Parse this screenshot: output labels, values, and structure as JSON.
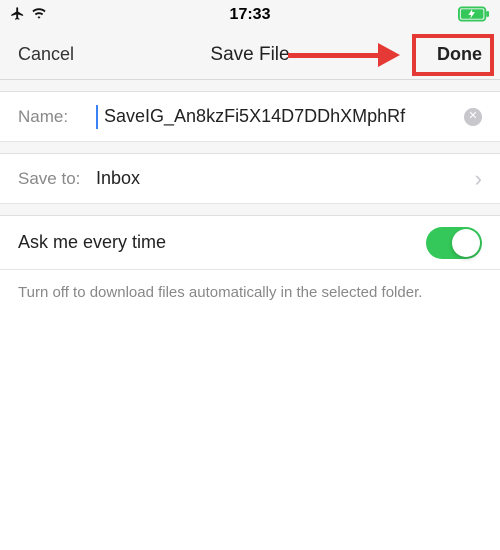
{
  "status": {
    "time": "17:33"
  },
  "nav": {
    "cancel": "Cancel",
    "title": "Save File",
    "done": "Done"
  },
  "name": {
    "label": "Name:",
    "value": "SaveIG_An8kzFi5X14D7DDhXMphRf"
  },
  "saveto": {
    "label": "Save to:",
    "value": "Inbox"
  },
  "toggle": {
    "label": "Ask me every time",
    "on": true
  },
  "desc": "Turn off to download files automatically in the selected folder."
}
